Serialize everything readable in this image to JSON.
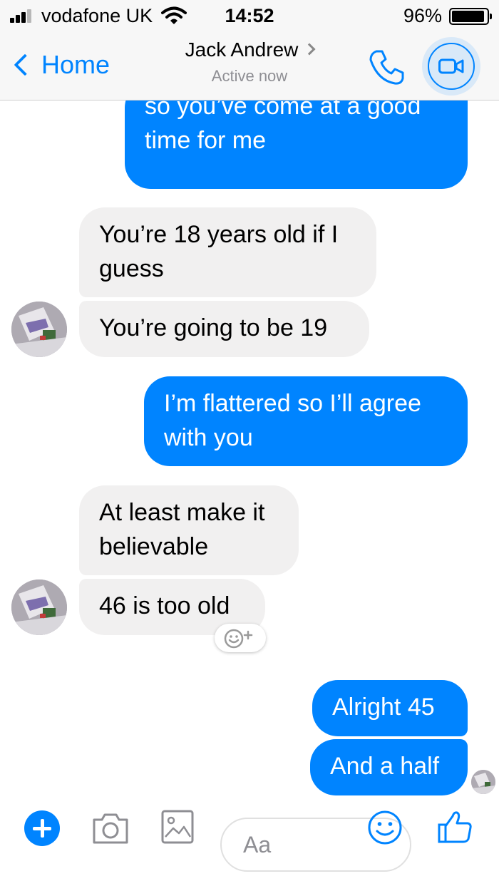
{
  "status_bar": {
    "carrier": "vodafone UK",
    "time": "14:52",
    "battery_percent": "96%",
    "battery_level": 0.96,
    "signal_bars_filled": 3,
    "signal_bars_total": 4
  },
  "nav": {
    "back_label": "Home",
    "contact_name": "Jack Andrew",
    "status": "Active now",
    "icons": {
      "back": "chevron-left-icon",
      "contact_details": "chevron-right-icon",
      "call": "phone-icon",
      "video": "video-camera-icon"
    }
  },
  "messages": [
    {
      "direction": "out",
      "lines": [
        "so you’ve come at a good",
        "time for me"
      ]
    },
    {
      "direction": "in",
      "lines": [
        "You’re 18 years old if I",
        "guess"
      ]
    },
    {
      "direction": "in",
      "lines": [
        "You’re going to be 19"
      ]
    },
    {
      "direction": "out",
      "lines": [
        "I’m flattered so I’ll agree",
        "with you"
      ]
    },
    {
      "direction": "in",
      "lines": [
        "At least make it",
        "believable"
      ]
    },
    {
      "direction": "in",
      "lines": [
        "46 is too old"
      ]
    },
    {
      "direction": "out",
      "lines": [
        "Alright 45"
      ]
    },
    {
      "direction": "out",
      "lines": [
        "And a half"
      ]
    }
  ],
  "composer": {
    "placeholder": "Aa",
    "icons": {
      "add": "plus-icon",
      "camera": "camera-icon",
      "gallery": "image-icon",
      "emoji": "smiley-icon",
      "like": "thumbs-up-icon",
      "reaction": "add-reaction-icon"
    }
  },
  "colors": {
    "accent": "#0084ff",
    "outgoing_bubble": "#0084ff",
    "incoming_bubble": "#f1f0f0",
    "bar_background": "#f7f7f7",
    "secondary_text": "#8e8e93"
  }
}
